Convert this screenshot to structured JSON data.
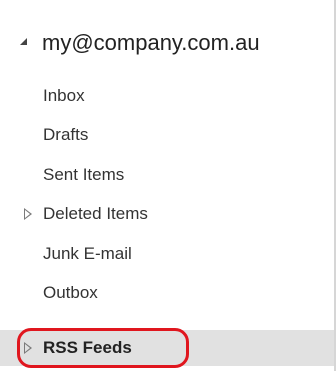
{
  "folder_pane": {
    "account": {
      "label": "my@company.com.au",
      "caret_icon": "expanded-triangle-icon"
    },
    "folders": [
      {
        "label": "Inbox",
        "has_children": false,
        "selected": false
      },
      {
        "label": "Drafts",
        "has_children": false,
        "selected": false
      },
      {
        "label": "Sent Items",
        "has_children": false,
        "selected": false
      },
      {
        "label": "Deleted Items",
        "has_children": true,
        "selected": false,
        "toggle_icon": "collapsed-triangle-icon"
      },
      {
        "label": "Junk E-mail",
        "has_children": false,
        "selected": false
      },
      {
        "label": "Outbox",
        "has_children": false,
        "selected": false
      },
      {
        "label": "RSS Feeds",
        "has_children": true,
        "selected": true,
        "toggle_icon": "collapsed-triangle-icon"
      }
    ]
  },
  "colors": {
    "selection_background": "#e1e1e1",
    "highlight_ring": "#e0161e",
    "pane_border": "#d6d6d6"
  }
}
